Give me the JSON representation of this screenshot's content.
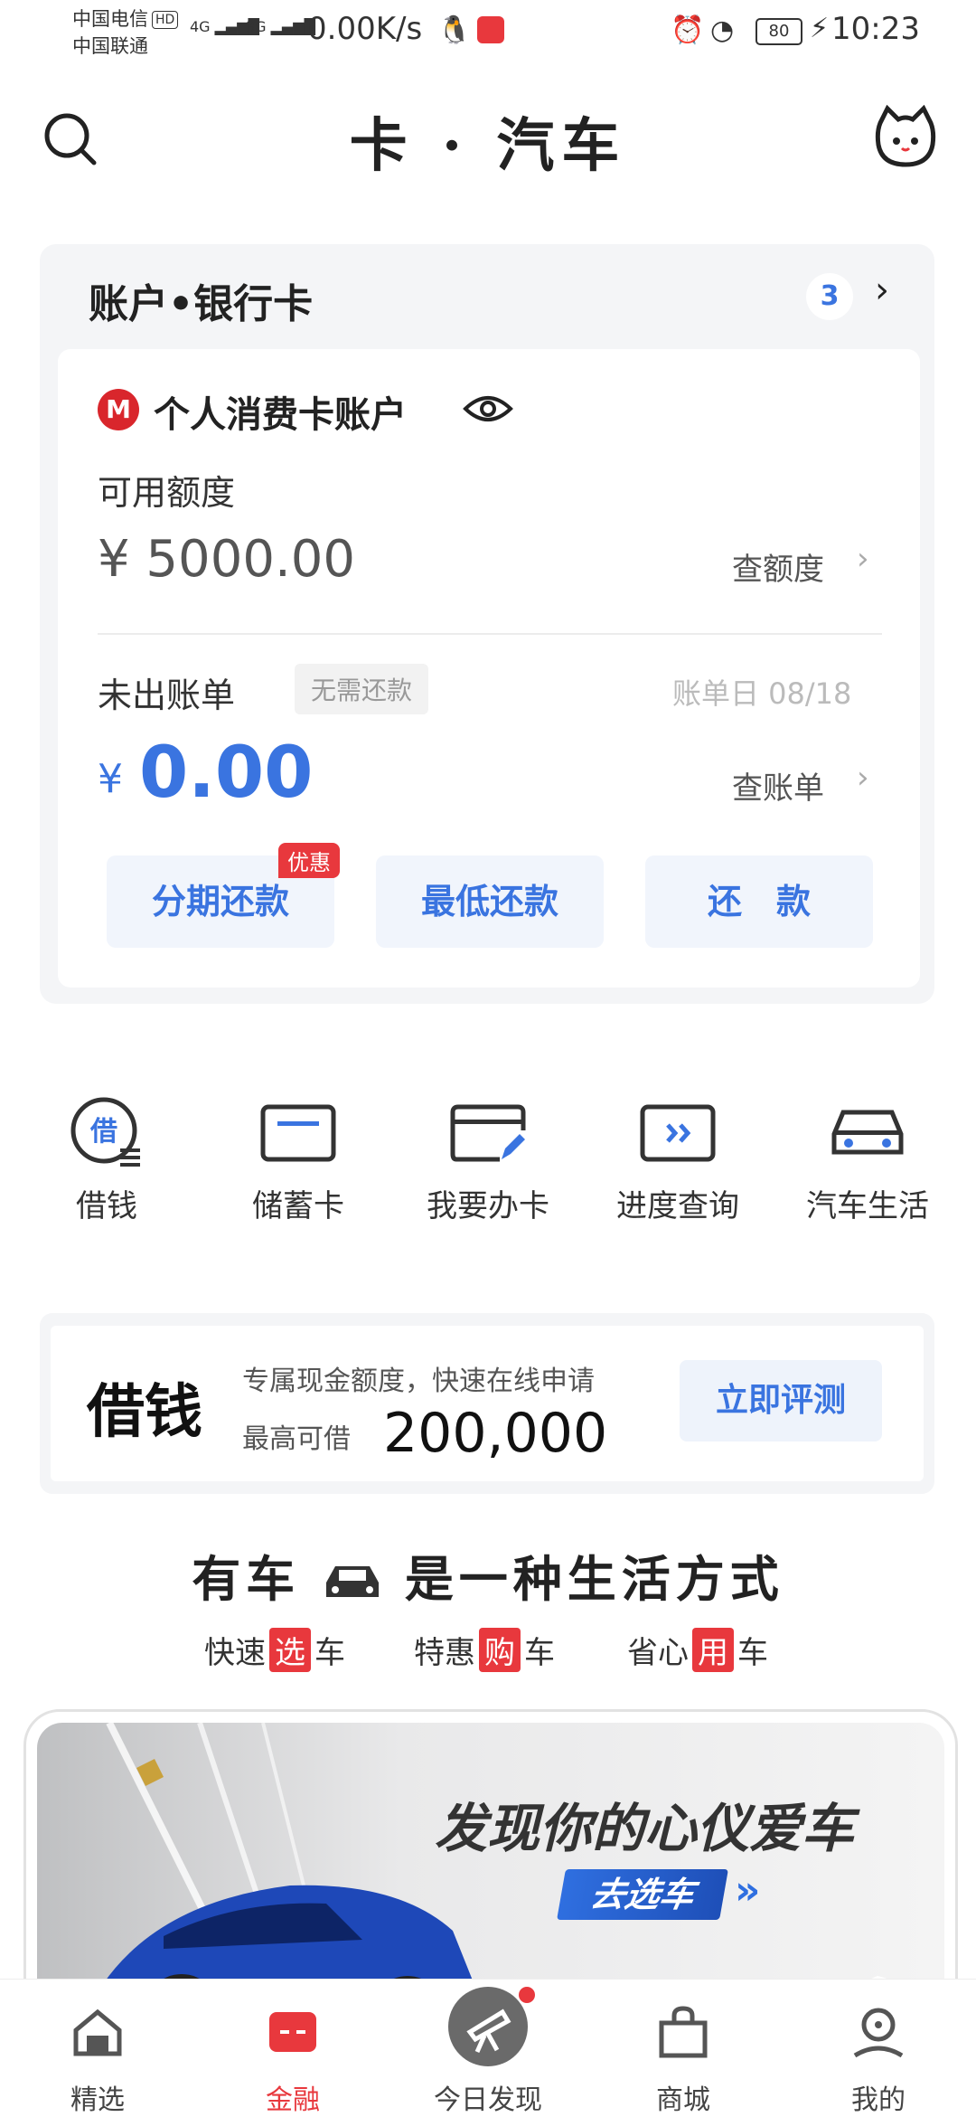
{
  "status_bar": {
    "carrier1": "中国电信",
    "carrier1_badge": "HD",
    "carrier2": "中国联通",
    "net1": "4G",
    "net2": "3G",
    "speed": "0.00K/s",
    "battery": "80",
    "time": "10:23"
  },
  "header": {
    "title": "卡 · 汽车"
  },
  "account_card": {
    "title": "账户•银行卡",
    "count": "3",
    "account_name": "个人消费卡账户",
    "logo_text": "M",
    "available_label": "可用额度",
    "available_amount": "¥ 5000.00",
    "check_limit_link": "查额度",
    "unbilled_label": "未出账单",
    "no_repay_badge": "无需还款",
    "bill_date": "账单日 08/18",
    "currency": "¥",
    "unbilled_amount": "0.00",
    "check_bill_link": "查账单",
    "buttons": [
      {
        "label": "分期还款",
        "promo": "优惠"
      },
      {
        "label": "最低还款"
      },
      {
        "label": "还　款"
      }
    ]
  },
  "quick_actions": [
    {
      "label": "借钱",
      "icon": "borrow-icon",
      "glyph": "借"
    },
    {
      "label": "储蓄卡",
      "icon": "debit-card-icon"
    },
    {
      "label": "我要办卡",
      "icon": "apply-card-icon"
    },
    {
      "label": "进度查询",
      "icon": "progress-icon"
    },
    {
      "label": "汽车生活",
      "icon": "car-icon"
    }
  ],
  "loan": {
    "title": "借钱",
    "desc": "专属现金额度，快速在线申请",
    "max_label": "最高可借",
    "max_amount": "200,000",
    "button": "立即评测"
  },
  "car_section": {
    "title_left": "有车",
    "title_right": "是一种生活方式",
    "features": [
      {
        "pre": "快速",
        "hl": "选",
        "post": "车"
      },
      {
        "pre": "特惠",
        "hl": "购",
        "post": "车"
      },
      {
        "pre": "省心",
        "hl": "用",
        "post": "车"
      }
    ],
    "banner_slogan": "发现你的心仪爱车",
    "banner_button": "去选车"
  },
  "bottom_nav": [
    {
      "label": "精选",
      "icon": "home-icon",
      "active": false
    },
    {
      "label": "金融",
      "icon": "finance-icon",
      "active": true
    },
    {
      "label": "今日发现",
      "icon": "telescope-icon",
      "active": false
    },
    {
      "label": "商城",
      "icon": "shopping-bag-icon",
      "active": false
    },
    {
      "label": "我的",
      "icon": "profile-icon",
      "active": false
    }
  ],
  "colors": {
    "accent_blue": "#3a74e0",
    "accent_red": "#e8383d"
  }
}
